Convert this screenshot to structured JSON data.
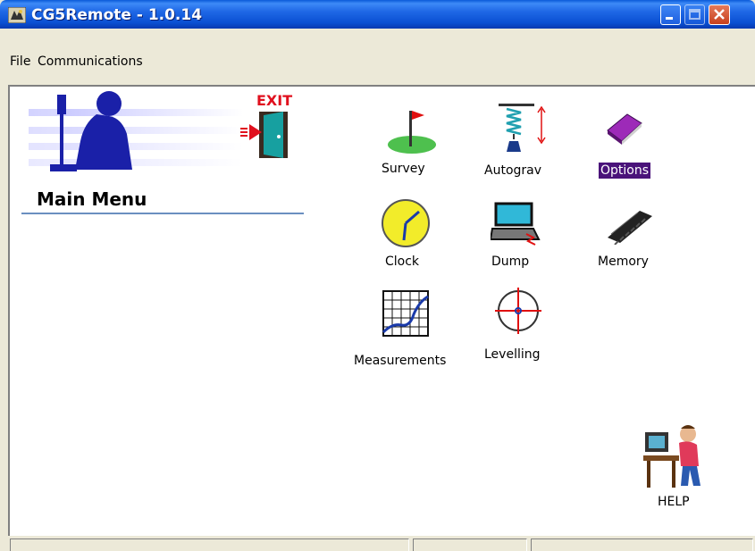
{
  "window": {
    "title": "CG5Remote - 1.0.14"
  },
  "menubar": {
    "items": [
      {
        "label": "File"
      },
      {
        "label": "Communications"
      }
    ]
  },
  "sidebar": {
    "exit_label": "EXIT",
    "main_menu_label": "Main Menu"
  },
  "icons": {
    "survey": {
      "label": "Survey",
      "icon": "flag-on-hill-icon"
    },
    "autograv": {
      "label": "Autograv",
      "icon": "spring-weight-icon"
    },
    "options": {
      "label": "Options",
      "icon": "book-icon"
    },
    "clock": {
      "label": "Clock",
      "icon": "clock-icon"
    },
    "dump": {
      "label": "Dump",
      "icon": "laptop-icon"
    },
    "memory": {
      "label": "Memory",
      "icon": "memory-chip-icon"
    },
    "measurements": {
      "label": "Measurements",
      "icon": "graph-icon"
    },
    "levelling": {
      "label": "Levelling",
      "icon": "crosshair-icon"
    },
    "help": {
      "label": "HELP",
      "icon": "person-at-computer-icon"
    }
  },
  "colors": {
    "titlebar": "#0a4fd2",
    "options_highlight": "#4a137a",
    "exit_red": "#e0101e"
  }
}
